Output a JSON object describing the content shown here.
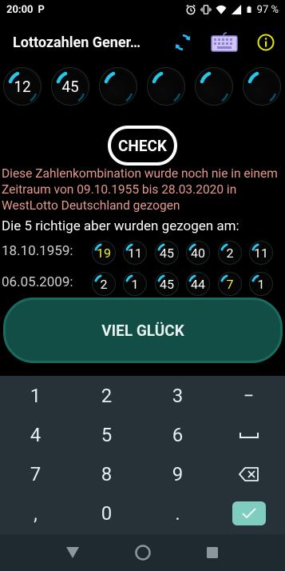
{
  "status_bar": {
    "time": "20:00",
    "app_letter": "P",
    "battery": "97 %"
  },
  "app_bar": {
    "title": "Lottozahlen Gener…",
    "refresh_icon": "refresh-icon",
    "keyboard_icon": "keyboard-icon",
    "info_icon": "info-icon",
    "accent_color": "#29b6f6",
    "info_color": "#e6e600"
  },
  "selected_balls": [
    "12",
    "45",
    "",
    "",
    "",
    ""
  ],
  "check_button": {
    "label": "CHECK"
  },
  "info_text": "Diese Zahlenkombination wurde noch nie in einem Zeitraum von 09.10.1955 bis 28.03.2020 in WestLotto Deutschland gezogen",
  "richtige_text": "Die 5 richtige aber wurden gezogen am:",
  "draws": [
    {
      "date": "18.10.1959:",
      "numbers": [
        {
          "value": "19",
          "highlight": true
        },
        {
          "value": "11",
          "highlight": false
        },
        {
          "value": "45",
          "highlight": false
        },
        {
          "value": "40",
          "highlight": false
        },
        {
          "value": "2",
          "highlight": false
        },
        {
          "value": "11",
          "highlight": false
        }
      ]
    },
    {
      "date": "06.05.2009:",
      "numbers": [
        {
          "value": "2",
          "highlight": false
        },
        {
          "value": "1",
          "highlight": false
        },
        {
          "value": "45",
          "highlight": false
        },
        {
          "value": "44",
          "highlight": false
        },
        {
          "value": "7",
          "highlight": true
        },
        {
          "value": "1",
          "highlight": false
        }
      ]
    }
  ],
  "viel_glueck_button": {
    "label": "VIEL GLÜCK"
  },
  "keyboard": {
    "keys": [
      [
        "1",
        "2",
        "3",
        "−"
      ],
      [
        "4",
        "5",
        "6",
        "space"
      ],
      [
        "7",
        "8",
        "9",
        "backspace"
      ],
      [
        ",",
        "0",
        ".",
        "done"
      ]
    ]
  },
  "nav_bar": {
    "back": "back-triangle-icon",
    "home": "home-circle-icon",
    "recents": "recents-square-icon"
  }
}
